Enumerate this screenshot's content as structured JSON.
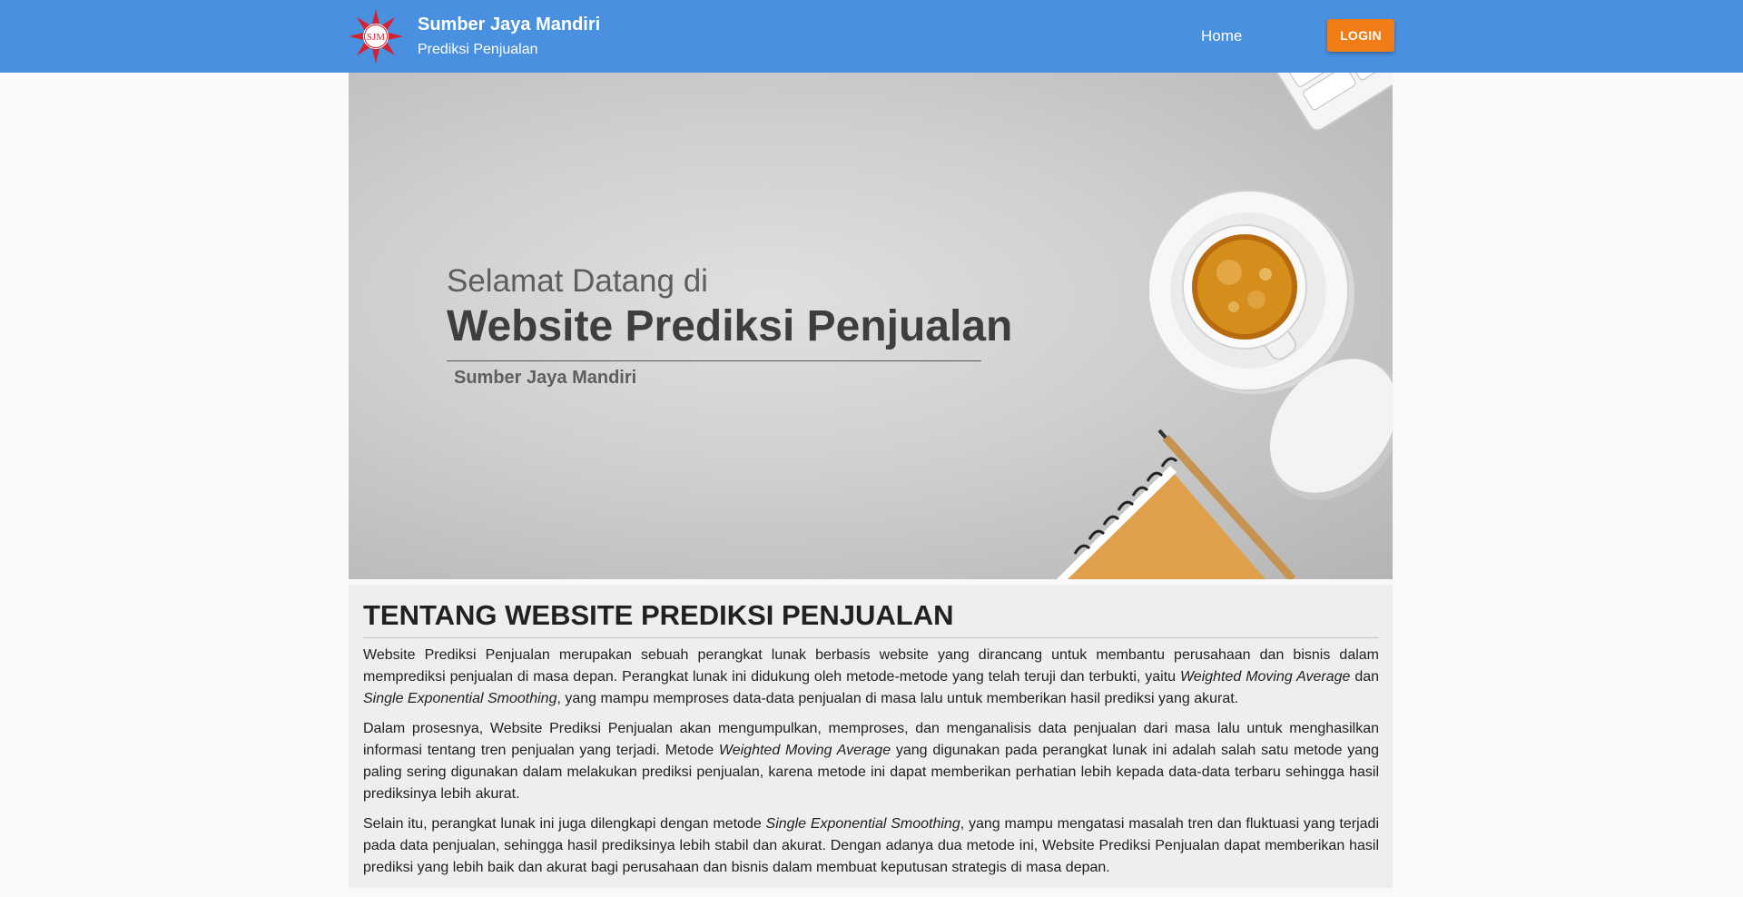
{
  "header": {
    "brand_title": "Sumber Jaya Mandiri",
    "brand_subtitle": "Prediksi Penjualan",
    "logo_text": "SJM",
    "nav_home": "Home",
    "nav_login": "LOGIN"
  },
  "hero": {
    "greeting": "Selamat Datang di",
    "title": "Website Prediksi Penjualan",
    "company": "Sumber Jaya Mandiri"
  },
  "about": {
    "title": "TENTANG WEBSITE PREDIKSI PENJUALAN",
    "p1": {
      "a": "Website Prediksi Penjualan merupakan sebuah perangkat lunak berbasis website yang dirancang untuk membantu perusahaan dan bisnis dalam memprediksi penjualan di masa depan. Perangkat lunak ini didukung oleh metode-metode yang telah teruji dan terbukti, yaitu ",
      "wma": "Weighted Moving Average",
      "b": " dan ",
      "ses": "Single Exponential Smoothing",
      "c": ", yang mampu memproses data-data penjualan di masa lalu untuk memberikan hasil prediksi yang akurat."
    },
    "p2": {
      "a": "Dalam prosesnya, Website Prediksi Penjualan akan mengumpulkan, memproses, dan menganalisis data penjualan dari masa lalu untuk menghasilkan informasi tentang tren penjualan yang terjadi. Metode ",
      "wma": "Weighted Moving Average",
      "b": " yang digunakan pada perangkat lunak ini adalah salah satu metode yang paling sering digunakan dalam melakukan prediksi penjualan, karena metode ini dapat memberikan perhatian lebih kepada data-data terbaru sehingga hasil prediksinya lebih akurat."
    },
    "p3": {
      "a": "Selain itu, perangkat lunak ini juga dilengkapi dengan metode ",
      "ses": "Single Exponential Smoothing",
      "b": ", yang mampu mengatasi masalah tren dan fluktuasi yang terjadi pada data penjualan, sehingga hasil prediksinya lebih stabil dan akurat. Dengan adanya dua metode ini, Website Prediksi Penjualan dapat memberikan hasil prediksi yang lebih baik dan akurat bagi perusahaan dan bisnis dalam membuat keputusan strategis di masa depan."
    }
  },
  "colors": {
    "navbar": "#4a90e0",
    "login_button": "#f07c15",
    "logo_red": "#d62230"
  },
  "icons": {
    "logo": "sjm-star-logo"
  }
}
